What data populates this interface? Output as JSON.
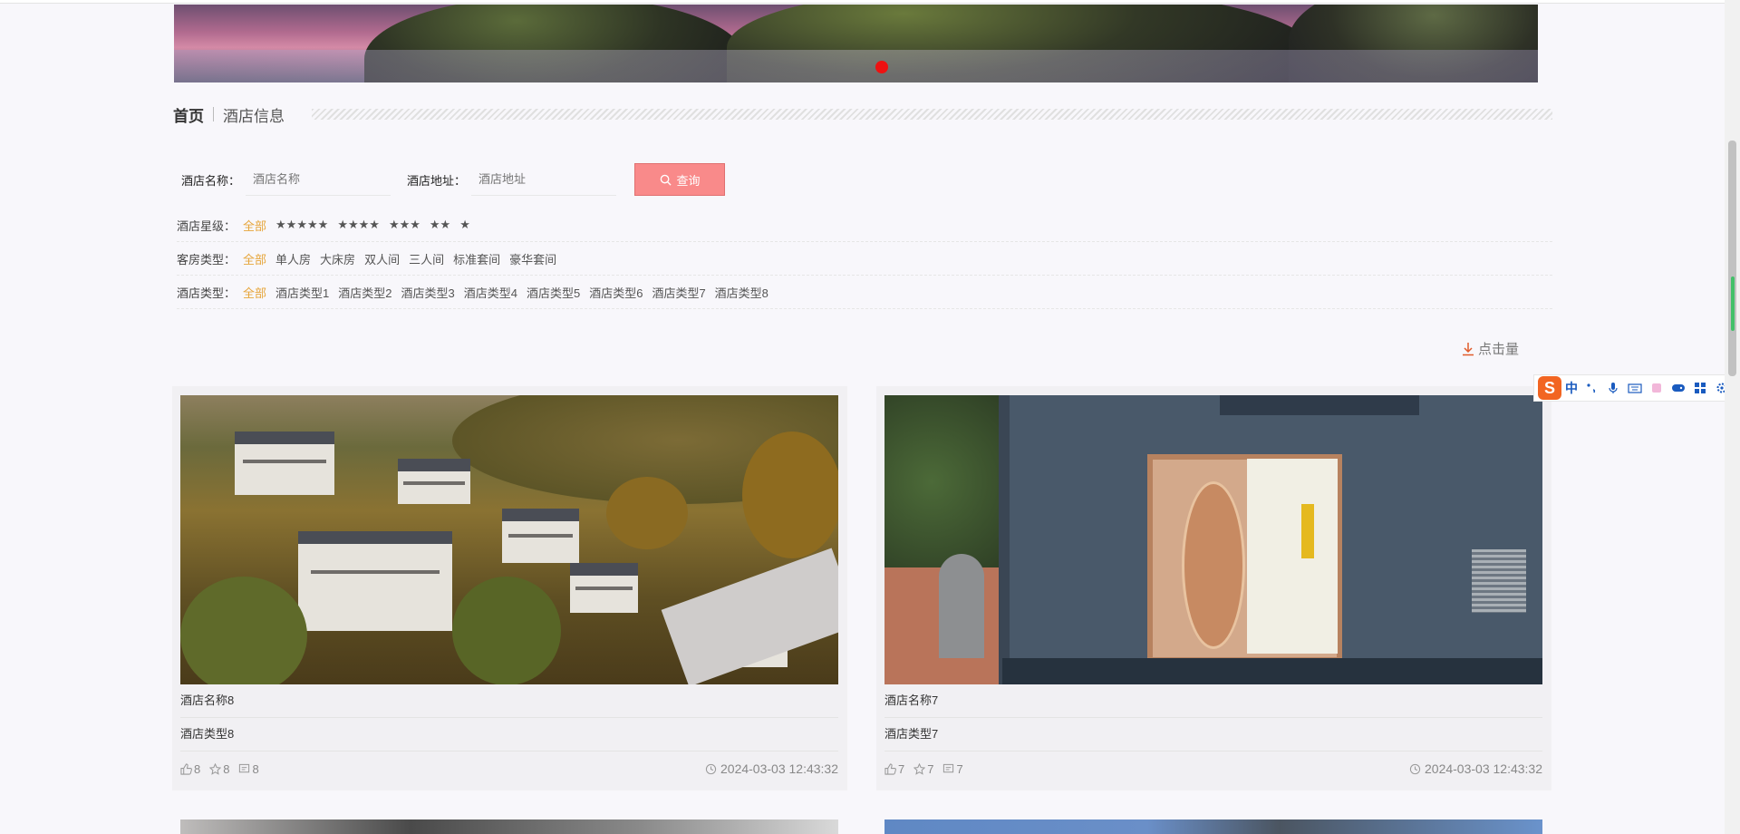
{
  "breadcrumb": {
    "home": "首页",
    "current": "酒店信息"
  },
  "search": {
    "name_label": "酒店名称：",
    "name_placeholder": "酒店名称",
    "address_label": "酒店地址：",
    "address_placeholder": "酒店地址",
    "button_label": "查询"
  },
  "filters": {
    "star": {
      "label": "酒店星级：",
      "options": [
        "全部",
        "★★★★★",
        "★★★★",
        "★★★",
        "★★",
        "★"
      ]
    },
    "room": {
      "label": "客房类型：",
      "options": [
        "全部",
        "单人房",
        "大床房",
        "双人间",
        "三人间",
        "标准套间",
        "豪华套间"
      ]
    },
    "hotel_type": {
      "label": "酒店类型：",
      "options": [
        "全部",
        "酒店类型1",
        "酒店类型2",
        "酒店类型3",
        "酒店类型4",
        "酒店类型5",
        "酒店类型6",
        "酒店类型7",
        "酒店类型8"
      ]
    }
  },
  "sort": {
    "label": "点击量"
  },
  "cards": [
    {
      "name": "酒店名称8",
      "type": "酒店类型8",
      "likes": "8",
      "favorites": "8",
      "comments": "8",
      "date": "2024-03-03 12:43:32"
    },
    {
      "name": "酒店名称7",
      "type": "酒店类型7",
      "likes": "7",
      "favorites": "7",
      "comments": "7",
      "date": "2024-03-03 12:43:32"
    }
  ],
  "ime": {
    "logo": "S",
    "mode": "中"
  },
  "colors": {
    "accent": "#e6a53a",
    "button": "#f98a8a",
    "carousel_dot": "#ee1111"
  }
}
